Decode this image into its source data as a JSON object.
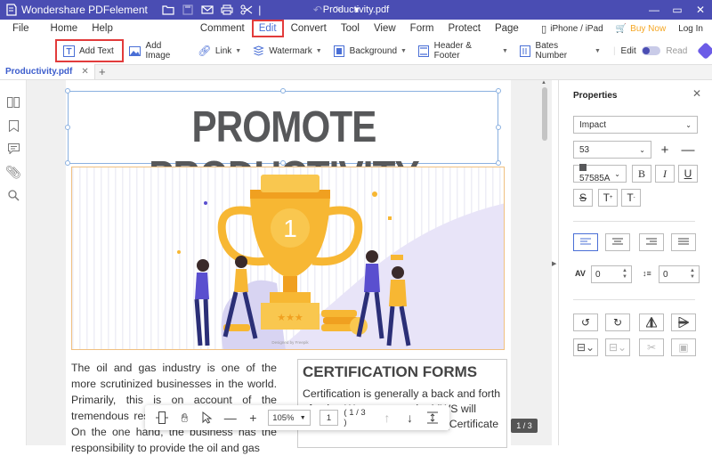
{
  "app": {
    "name": "Wondershare PDFelement",
    "doc_title": "Productivity.pdf"
  },
  "menu": {
    "items": [
      "File",
      "Home",
      "Help",
      "Comment",
      "Edit",
      "Convert",
      "Tool",
      "View",
      "Form",
      "Protect",
      "Page"
    ],
    "active": "Edit",
    "right": {
      "device": "iPhone / iPad",
      "buy": "Buy Now",
      "login": "Log In"
    }
  },
  "toolbar": {
    "add_text": "Add Text",
    "add_image": "Add Image",
    "link": "Link",
    "watermark": "Watermark",
    "background": "Background",
    "header_footer": "Header & Footer",
    "bates": "Bates Number",
    "edit": "Edit",
    "read": "Read"
  },
  "tab": {
    "name": "Productivity.pdf"
  },
  "page": {
    "heading": "PROMOTE PRODUCTIVITY",
    "illustration_caption": "Designed by Freepik",
    "trophy_number": "1",
    "col1_text": "The oil and gas industry is one of the more scrutinized businesses in the world. Primarily, this is on account of the tremendous responsibility a... possesses. On the one hand, the business has the responsibility to provide the oil and gas",
    "col2_title": "CERTIFICATION FORMS",
    "col2_text": "Certification is generally a back and forth of ... ing Warranty ... e the MWS will determine if you have a COA (Certificate"
  },
  "floatbar": {
    "zoom": "105%",
    "page_input": "1",
    "page_total": "( 1 / 3 )"
  },
  "page_chip": "1 / 3",
  "properties": {
    "title": "Properties",
    "font": "Impact",
    "size": "53",
    "color": "57585A",
    "char_spacing": "0",
    "line_spacing": "0"
  },
  "colors": {
    "titlebar": "#4a4db3",
    "accent": "#4a6fd6",
    "highlight": "#e23b3b",
    "heading_text": "#57585a"
  }
}
